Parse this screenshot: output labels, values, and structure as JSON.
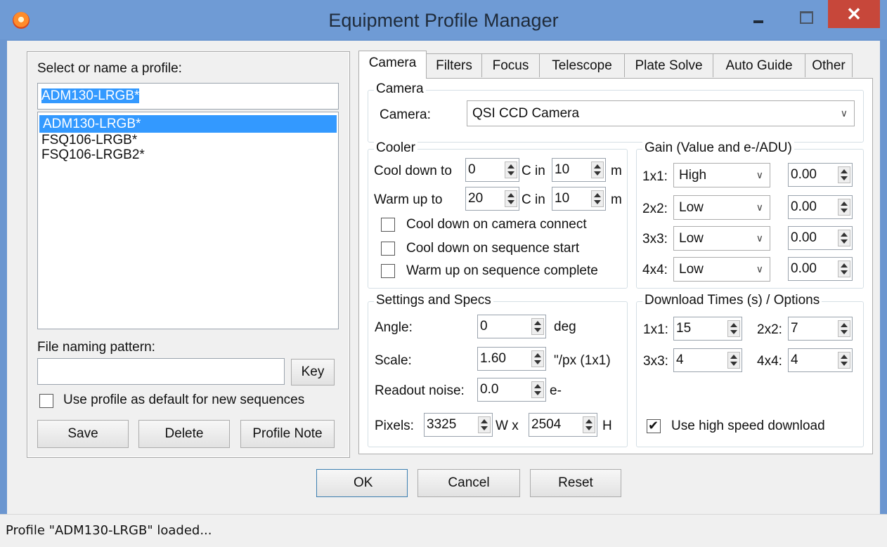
{
  "window": {
    "title": "Equipment Profile Manager",
    "close_glyph": "✕"
  },
  "profile_panel": {
    "select_label": "Select or name a profile:",
    "name_input_value": "ADM130-LRGB*",
    "profiles": [
      "ADM130-LRGB*",
      "FSQ106-LRGB*",
      "FSQ106-LRGB2*"
    ],
    "selected_profile": "ADM130-LRGB*",
    "file_naming_label": "File naming pattern:",
    "file_naming_value": "",
    "key_button": "Key",
    "default_checkbox_label": "Use profile as default for new sequences",
    "default_checkbox_checked": false,
    "save_button": "Save",
    "delete_button": "Delete",
    "profile_note_button": "Profile Note"
  },
  "tabs": [
    "Camera",
    "Filters",
    "Focus",
    "Telescope",
    "Plate Solve",
    "Auto Guide",
    "Other"
  ],
  "active_tab": "Camera",
  "camera_group": {
    "title": "Camera",
    "label": "Camera:",
    "value": "QSI CCD Camera"
  },
  "cooler": {
    "title": "Cooler",
    "cool_label": "Cool down to",
    "cool_temp": "0",
    "cool_c_in": "C in",
    "cool_minutes": "10",
    "cool_unit": "m",
    "warm_label": "Warm up to",
    "warm_temp": "20",
    "warm_c_in": "C in",
    "warm_minutes": "10",
    "warm_unit": "m",
    "opt_connect": "Cool down on camera connect",
    "opt_seq_start": "Cool down on sequence start",
    "opt_seq_complete": "Warm up on sequence complete"
  },
  "gain": {
    "title": "Gain (Value and e-/ADU)",
    "rows": [
      {
        "bin": "1x1:",
        "value": "High",
        "eadu": "0.00"
      },
      {
        "bin": "2x2:",
        "value": "Low",
        "eadu": "0.00"
      },
      {
        "bin": "3x3:",
        "value": "Low",
        "eadu": "0.00"
      },
      {
        "bin": "4x4:",
        "value": "Low",
        "eadu": "0.00"
      }
    ]
  },
  "specs": {
    "title": "Settings and Specs",
    "angle_label": "Angle:",
    "angle_value": "0",
    "angle_unit": "deg",
    "scale_label": "Scale:",
    "scale_value": "1.60",
    "scale_unit": "\"/px (1x1)",
    "readout_label": "Readout noise:",
    "readout_value": "0.0",
    "readout_unit": "e-",
    "pixels_label": "Pixels:",
    "pixels_w": "3325",
    "pixels_w_unit": "W x",
    "pixels_h": "2504",
    "pixels_h_unit": "H"
  },
  "download": {
    "title": "Download Times (s) / Options",
    "b1_label": "1x1:",
    "b1_value": "15",
    "b2_label": "2x2:",
    "b2_value": "7",
    "b3_label": "3x3:",
    "b3_value": "4",
    "b4_label": "4x4:",
    "b4_value": "4",
    "high_speed_label": "Use high speed download",
    "high_speed_checked": true
  },
  "footer": {
    "ok": "OK",
    "cancel": "Cancel",
    "reset": "Reset"
  },
  "status": "Profile \"ADM130-LRGB\" loaded...",
  "icons": {
    "app": "app-logo-icon",
    "dropdown": "chevron-down-icon",
    "spinner": "spin-arrows-icon",
    "check": "checkmark-icon"
  }
}
